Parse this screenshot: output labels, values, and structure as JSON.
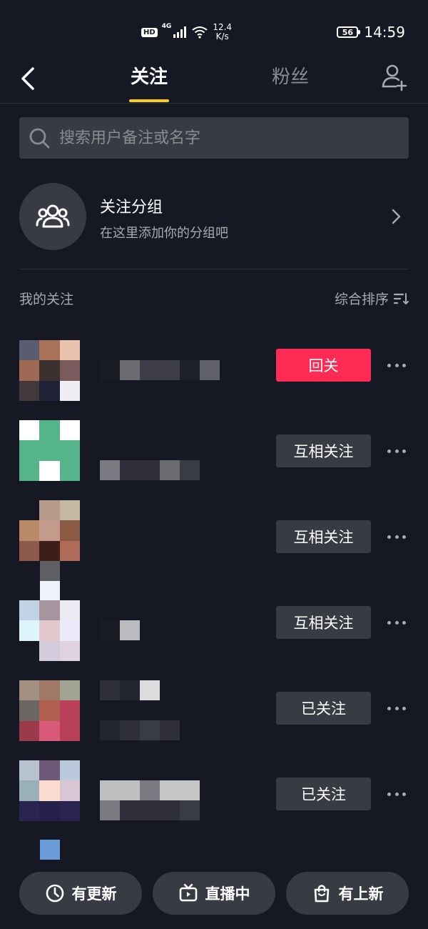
{
  "status_bar": {
    "hd": "HD",
    "network": "4G",
    "speed_value": "12.4",
    "speed_unit": "K/s",
    "battery": "56",
    "time": "14:59"
  },
  "nav": {
    "tabs": [
      {
        "label": "关注",
        "active": true
      },
      {
        "label": "粉丝",
        "active": false
      }
    ],
    "accent_color": "#face15"
  },
  "search": {
    "placeholder": "搜索用户备注或名字"
  },
  "group": {
    "title": "关注分组",
    "subtitle": "在这里添加你的分组吧"
  },
  "section": {
    "title": "我的关注",
    "sort_label": "综合排序"
  },
  "users": [
    {
      "button": "回关",
      "primary": true
    },
    {
      "button": "互相关注",
      "primary": false
    },
    {
      "button": "互相关注",
      "primary": false
    },
    {
      "button": "互相关注",
      "primary": false
    },
    {
      "button": "已关注",
      "primary": false
    },
    {
      "button": "已关注",
      "primary": false
    }
  ],
  "bottom_tabs": [
    {
      "label": "有更新",
      "icon": "clock-icon"
    },
    {
      "label": "直播中",
      "icon": "tv-icon"
    },
    {
      "label": "有上新",
      "icon": "shopping-bag-icon"
    }
  ],
  "colors": {
    "background": "#161823",
    "primary_button": "#fe2c55",
    "secondary_button": "#393b44"
  }
}
